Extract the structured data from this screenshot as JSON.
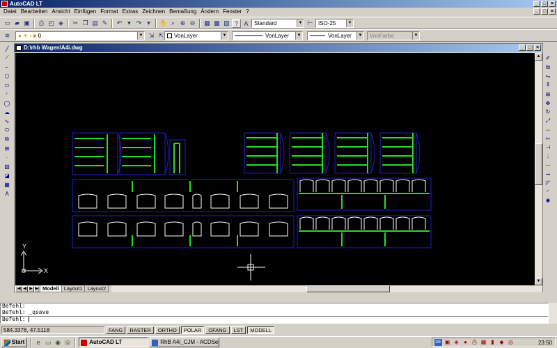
{
  "window": {
    "title": "AutoCAD LT",
    "min": "_",
    "max": "□",
    "close": "×"
  },
  "menu": [
    "Datei",
    "Bearbeiten",
    "Ansicht",
    "Einfügen",
    "Format",
    "Extras",
    "Zeichnen",
    "Bemaßung",
    "Ändern",
    "Fenster",
    "?"
  ],
  "toolbar": {
    "textstyle": "Standard",
    "dimstyle": "ISO-25",
    "layer": "0",
    "color": "VonLayer",
    "linetype": "VonLayer",
    "lineweight": "VonLayer",
    "plotstyle": "VonFarbe"
  },
  "drawing": {
    "title": "D:\\rhb Wagen\\A4i.dwg",
    "tabs": [
      "Modell",
      "Layout1",
      "Layout2"
    ],
    "ucs_x": "X",
    "ucs_y": "Y",
    "colors": {
      "outline": "#2020c8",
      "accent": "#20e020",
      "white": "#ffffff",
      "bg": "#000000"
    }
  },
  "command": {
    "lines": [
      "Befehl:",
      "Befehl: _qsave"
    ],
    "prompt": "Befehl:"
  },
  "status": {
    "coords": "584.3378, 47.5118",
    "toggles": [
      {
        "label": "FANG",
        "on": false
      },
      {
        "label": "RASTER",
        "on": false
      },
      {
        "label": "ORTHO",
        "on": false
      },
      {
        "label": "POLAR",
        "on": true
      },
      {
        "label": "OFANG",
        "on": false
      },
      {
        "label": "LST",
        "on": false
      },
      {
        "label": "MODELL",
        "on": true
      }
    ]
  },
  "taskbar": {
    "start": "Start",
    "items": [
      {
        "label": "AutoCAD LT",
        "active": true
      },
      {
        "label": "RhB A4i_CJM - ACDSee ...",
        "active": false
      }
    ],
    "clock": "23:50",
    "tray_icons": [
      "DE",
      "network-icon",
      "volume-icon",
      "antivirus-icon",
      "printer-icon",
      "display-icon",
      "battery-icon",
      "shield-icon",
      "update-icon"
    ]
  }
}
